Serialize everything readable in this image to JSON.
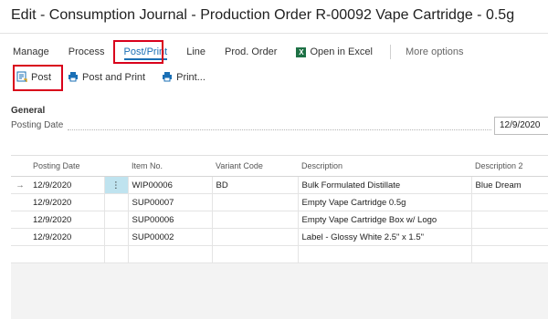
{
  "window": {
    "title": "Edit - Consumption Journal - Production Order R-00092 Vape Cartridge - 0.5g"
  },
  "menubar": {
    "manage": "Manage",
    "process": "Process",
    "post_print": "Post/Print",
    "line": "Line",
    "prod_order": "Prod. Order",
    "open_in_excel": "Open in Excel",
    "more_options": "More options"
  },
  "actions": {
    "post": "Post",
    "post_and_print": "Post and Print",
    "print": "Print..."
  },
  "general": {
    "section_title": "General",
    "posting_date_label": "Posting Date",
    "posting_date_value": "12/9/2020"
  },
  "grid": {
    "columns": [
      "Posting Date",
      "Item No.",
      "Variant Code",
      "Description",
      "Description 2"
    ],
    "rows": [
      {
        "indicator": "→",
        "posting_date": "12/9/2020",
        "item_no": "WIP00006",
        "variant_code": "BD",
        "description": "Bulk Formulated Distillate",
        "description2": "Blue Dream"
      },
      {
        "indicator": "",
        "posting_date": "12/9/2020",
        "item_no": "SUP00007",
        "variant_code": "",
        "description": "Empty Vape Cartridge 0.5g",
        "description2": ""
      },
      {
        "indicator": "",
        "posting_date": "12/9/2020",
        "item_no": "SUP00006",
        "variant_code": "",
        "description": "Empty Vape Cartridge Box w/ Logo",
        "description2": ""
      },
      {
        "indicator": "",
        "posting_date": "12/9/2020",
        "item_no": "SUP00002",
        "variant_code": "",
        "description": "Label - Glossy White 2.5\" x 1.5\"",
        "description2": ""
      }
    ],
    "row_menu_glyph": "⋮"
  },
  "colors": {
    "accent": "#1a6fb5",
    "highlight": "#d9001b",
    "excel": "#1e7145",
    "selected_cell": "#bfe3ef"
  }
}
